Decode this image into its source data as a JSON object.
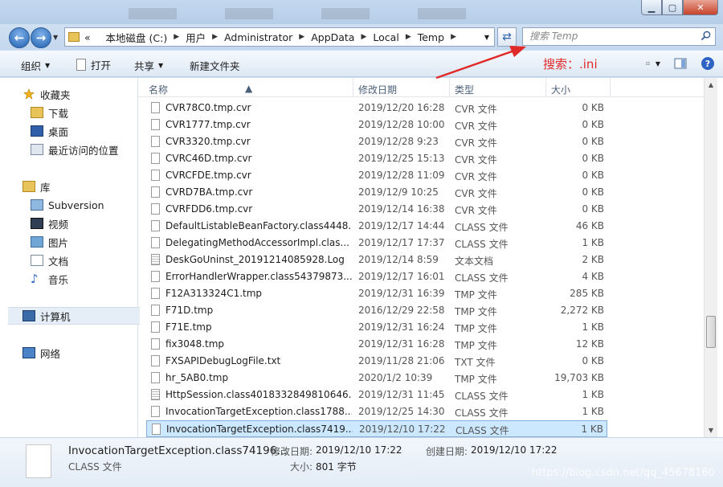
{
  "window": {
    "controls": {
      "minimize": "▁",
      "maximize": "▢",
      "close": "✕"
    }
  },
  "address": {
    "overflow": "«",
    "crumbs": [
      "本地磁盘 (C:)",
      "用户",
      "Administrator",
      "AppData",
      "Local",
      "Temp"
    ]
  },
  "search": {
    "placeholder": "搜索 Temp"
  },
  "toolbar": {
    "organize": "组织",
    "open": "打开",
    "share": "共享",
    "new_folder": "新建文件夹"
  },
  "annotation": "搜索：.ini",
  "nav": {
    "favorites": "收藏夹",
    "downloads": "下载",
    "desktop": "桌面",
    "recent": "最近访问的位置",
    "libraries": "库",
    "subversion": "Subversion",
    "videos": "视频",
    "pictures": "图片",
    "documents": "文档",
    "music": "音乐",
    "computer": "计算机",
    "network": "网络"
  },
  "columns": {
    "name": "名称",
    "date": "修改日期",
    "type": "类型",
    "size": "大小"
  },
  "files": [
    {
      "name": "CVR78C0.tmp.cvr",
      "date": "2019/12/20 16:28",
      "type": "CVR 文件",
      "size": "0 KB"
    },
    {
      "name": "CVR1777.tmp.cvr",
      "date": "2019/12/28 10:00",
      "type": "CVR 文件",
      "size": "0 KB"
    },
    {
      "name": "CVR3320.tmp.cvr",
      "date": "2019/12/28 9:23",
      "type": "CVR 文件",
      "size": "0 KB"
    },
    {
      "name": "CVRC46D.tmp.cvr",
      "date": "2019/12/25 15:13",
      "type": "CVR 文件",
      "size": "0 KB"
    },
    {
      "name": "CVRCFDE.tmp.cvr",
      "date": "2019/12/28 11:09",
      "type": "CVR 文件",
      "size": "0 KB"
    },
    {
      "name": "CVRD7BA.tmp.cvr",
      "date": "2019/12/9 10:25",
      "type": "CVR 文件",
      "size": "0 KB"
    },
    {
      "name": "CVRFDD6.tmp.cvr",
      "date": "2019/12/14 16:38",
      "type": "CVR 文件",
      "size": "0 KB"
    },
    {
      "name": "DefaultListableBeanFactory.class4448...",
      "date": "2019/12/17 14:44",
      "type": "CLASS 文件",
      "size": "46 KB"
    },
    {
      "name": "DelegatingMethodAccessorImpl.clas...",
      "date": "2019/12/17 17:37",
      "type": "CLASS 文件",
      "size": "1 KB"
    },
    {
      "name": "DeskGoUninst_20191214085928.Log",
      "date": "2019/12/14 8:59",
      "type": "文本文档",
      "size": "2 KB",
      "log": true
    },
    {
      "name": "ErrorHandlerWrapper.class54379873...",
      "date": "2019/12/17 16:01",
      "type": "CLASS 文件",
      "size": "4 KB"
    },
    {
      "name": "F12A313324C1.tmp",
      "date": "2019/12/31 16:39",
      "type": "TMP 文件",
      "size": "285 KB"
    },
    {
      "name": "F71D.tmp",
      "date": "2016/12/29 22:58",
      "type": "TMP 文件",
      "size": "2,272 KB"
    },
    {
      "name": "F71E.tmp",
      "date": "2019/12/31 16:24",
      "type": "TMP 文件",
      "size": "1 KB"
    },
    {
      "name": "fix3048.tmp",
      "date": "2019/12/31 16:28",
      "type": "TMP 文件",
      "size": "12 KB"
    },
    {
      "name": "FXSAPIDebugLogFile.txt",
      "date": "2019/11/28 21:06",
      "type": "TXT 文件",
      "size": "0 KB"
    },
    {
      "name": "hr_5AB0.tmp",
      "date": "2020/1/2 10:39",
      "type": "TMP 文件",
      "size": "19,703 KB"
    },
    {
      "name": "HttpSession.class4018332849810646...",
      "date": "2019/12/31 11:45",
      "type": "CLASS 文件",
      "size": "1 KB",
      "log": true
    },
    {
      "name": "InvocationTargetException.class1788...",
      "date": "2019/12/25 14:30",
      "type": "CLASS 文件",
      "size": "1 KB"
    },
    {
      "name": "InvocationTargetException.class7419...",
      "date": "2019/12/10 17:22",
      "type": "CLASS 文件",
      "size": "1 KB",
      "selected": true
    }
  ],
  "details": {
    "name": "InvocationTargetException.class74196...",
    "type": "CLASS 文件",
    "modified_label": "修改日期:",
    "modified": "2019/12/10 17:22",
    "created_label": "创建日期:",
    "created": "2019/12/10 17:22",
    "size_label": "大小:",
    "size": "801 字节"
  },
  "watermark": "https://blog.csdn.net/qq_45678160",
  "colors": {
    "annotation": "#e02a2a",
    "selection": "#cce8ff",
    "nav_bg": "#cfe0f2"
  }
}
